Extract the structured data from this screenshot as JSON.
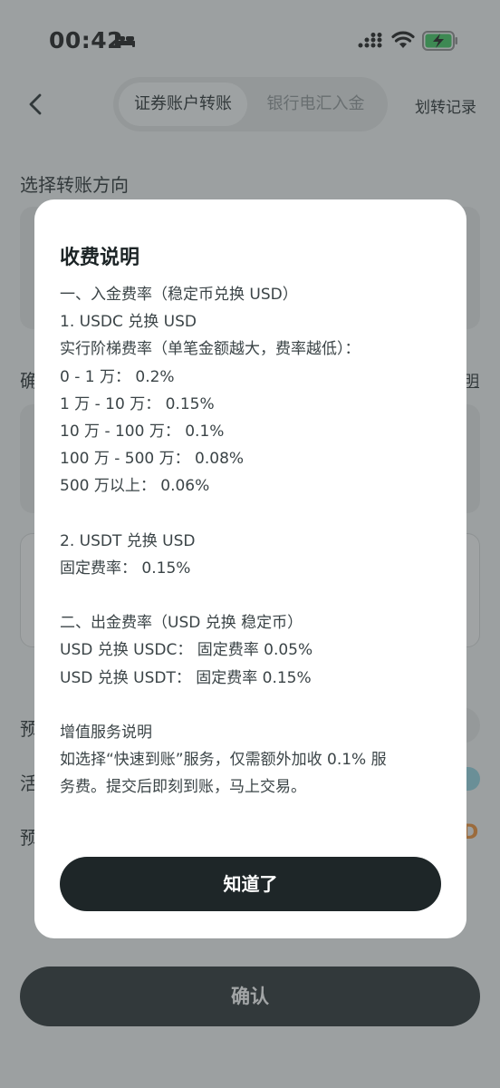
{
  "status_bar": {
    "time": "00:42"
  },
  "header": {
    "tabs": [
      {
        "label": "证券账户转账",
        "active": true
      },
      {
        "label": "银行电汇入金",
        "active": false
      }
    ],
    "history_label": "划转记录"
  },
  "page": {
    "section_title": "选择转账方向",
    "partial_title": "确",
    "partial_link": "明",
    "row_labels": [
      "预",
      "活",
      "预"
    ],
    "partial_amount_suffix": "D",
    "confirm_label": "确认"
  },
  "modal": {
    "title": "收费说明",
    "lines": [
      "一、入金费率（稳定币兑换 USD）",
      "1. USDC 兑换 USD",
      "实行阶梯费率（单笔金额越大，费率越低）：",
      "0 - 1 万： 0.2%",
      "1 万 - 10 万： 0.15%",
      "10 万 - 100 万： 0.1%",
      "100 万 - 500 万： 0.08%",
      "500 万以上： 0.06%",
      "",
      "2. USDT 兑换 USD",
      "固定费率： 0.15%",
      "",
      "二、出金费率（USD 兑换 稳定币）",
      "USD 兑换 USDC： 固定费率 0.05%",
      "USD 兑换 USDT： 固定费率 0.15%",
      "",
      "增值服务说明",
      "如选择“快速到账”服务，仅需额外加收 0.1% 服",
      "务费。提交后即刻到账，马上交易。"
    ],
    "ack_label": "知道了"
  },
  "colors": {
    "primary_dark": "#1e2628",
    "overlay": "rgba(70,76,78,0.5)",
    "battery_green": "#34c759",
    "accent_orange": "#f08a2b"
  },
  "icons": [
    "bed-icon",
    "signal-icon",
    "wifi-icon",
    "battery-charging-icon",
    "back-chevron-icon"
  ]
}
